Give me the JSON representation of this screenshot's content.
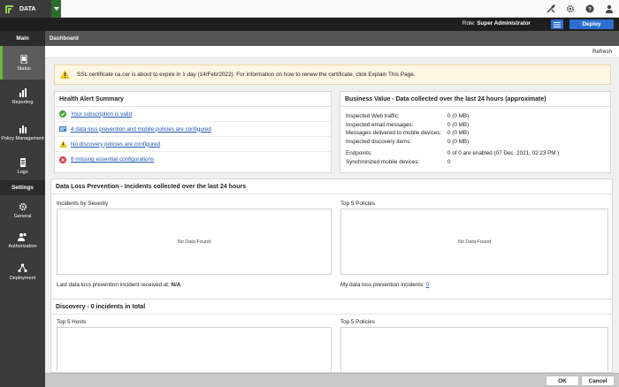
{
  "app": {
    "name": "DATA"
  },
  "header": {
    "role_label": "Role:",
    "role_value": "Super Administrator",
    "deploy_label": "Deploy"
  },
  "sidebar": {
    "sections": [
      {
        "label": "Main",
        "items": [
          {
            "label": "Status",
            "icon": "status-icon",
            "active": true
          },
          {
            "label": "Reporting",
            "icon": "bar-chart-icon"
          },
          {
            "label": "Policy Management",
            "icon": "policy-chart-icon"
          },
          {
            "label": "Logs",
            "icon": "logs-icon"
          }
        ]
      },
      {
        "label": "Settings",
        "items": [
          {
            "label": "General",
            "icon": "gear-icon"
          },
          {
            "label": "Authorization",
            "icon": "users-icon"
          },
          {
            "label": "Deployment",
            "icon": "network-icon"
          }
        ]
      }
    ]
  },
  "dashboard": {
    "title": "Dashboard",
    "refresh_label": "Refresh",
    "alert": "SSL certificate ca.cer is about to expire in 1 day (14/Feb/2022). For information on how to renew the certificate, click Explain This Page."
  },
  "health": {
    "title": "Health Alert Summary",
    "items": [
      {
        "text": "Your subscription is valid",
        "status": "ok"
      },
      {
        "text": "4 data loss prevention and mobile policies are configured",
        "status": "info"
      },
      {
        "text": "No discovery policies are configured",
        "status": "warning"
      },
      {
        "text": "8 missing essential configurations",
        "status": "error"
      }
    ]
  },
  "business": {
    "title": "Business Value - Data collected over the last 24 hours (approximate)",
    "rows": [
      {
        "k": "Inspected Web traffic:",
        "v": "0 (0 MB)"
      },
      {
        "k": "Inspected email messages:",
        "v": "0 (0 MB)"
      },
      {
        "k": "Messages delivered to mobile devices:",
        "v": "0 (0 MB)"
      },
      {
        "k": "Inspected discovery items:",
        "v": "0 (0 MB)"
      }
    ],
    "rows2": [
      {
        "k": "Endpoints:",
        "v": "0 of 0 are enabled (07 Dec. 2021, 02:23 PM )"
      },
      {
        "k": "Synchronized mobile devices:",
        "v": "0"
      }
    ]
  },
  "dlp": {
    "title": "Data Loss Prevention - Incidents collected over the last 24 hours",
    "left_label": "Incidents by Severity",
    "right_label": "Top 5 Policies",
    "no_data": "No Data Found",
    "last_incident_label": "Last data loss prevention incident received at:",
    "last_incident_value": "N/A",
    "my_incidents_label": "My data loss prevention incidents:",
    "my_incidents_value": "0"
  },
  "discovery": {
    "title": "Discovery - 0 incidents in total",
    "left_label": "Top 5 Hosts",
    "right_label": "Top 5 Policies"
  },
  "footer": {
    "ok": "OK",
    "cancel": "Cancel"
  }
}
